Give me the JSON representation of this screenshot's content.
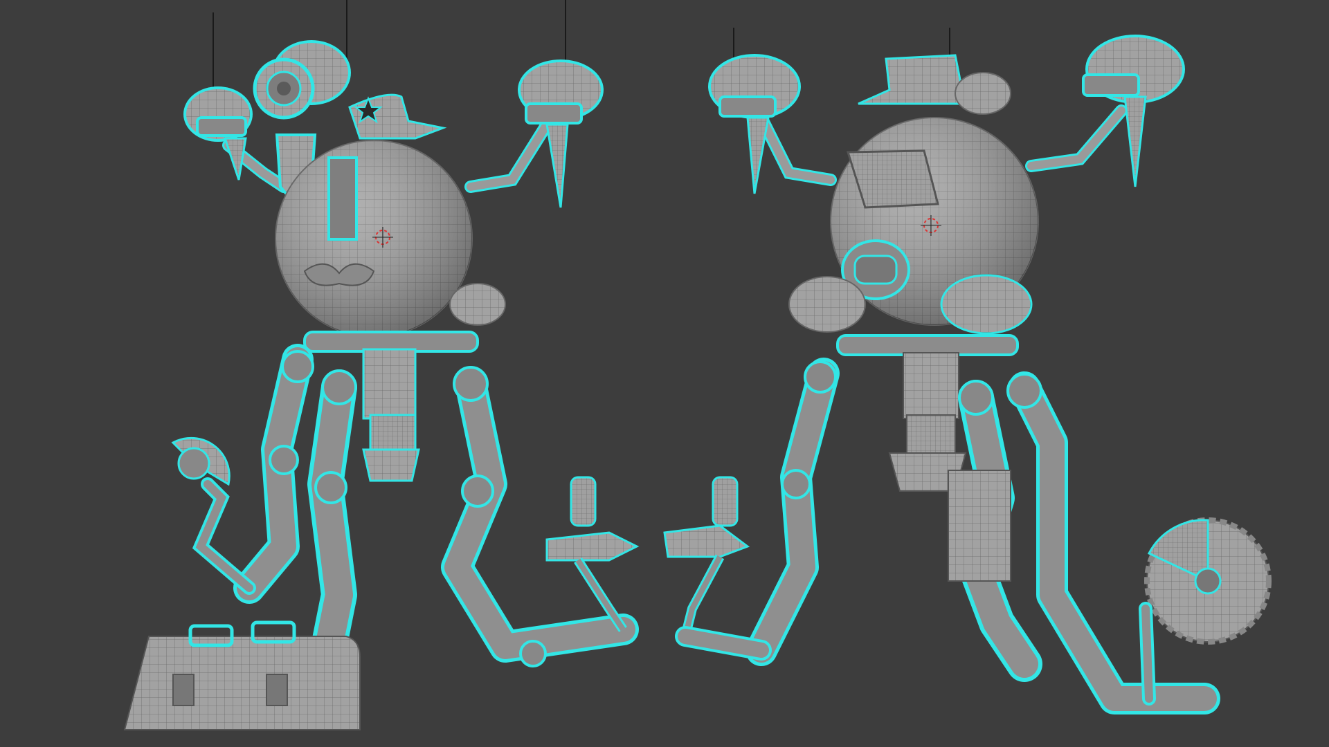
{
  "viewport": {
    "background": "#3d3d3d",
    "mesh_color": "#9c9c9c",
    "wire_color": "#5e5e5e",
    "selection_color": "#32e6e6"
  },
  "scene": {
    "models": [
      {
        "name": "robot-front-view",
        "view": "front"
      },
      {
        "name": "robot-back-view",
        "view": "back"
      }
    ],
    "props": [
      "suitcase",
      "saw-blade",
      "flamethrower"
    ],
    "cursor_icon": "3d-cursor-icon"
  }
}
